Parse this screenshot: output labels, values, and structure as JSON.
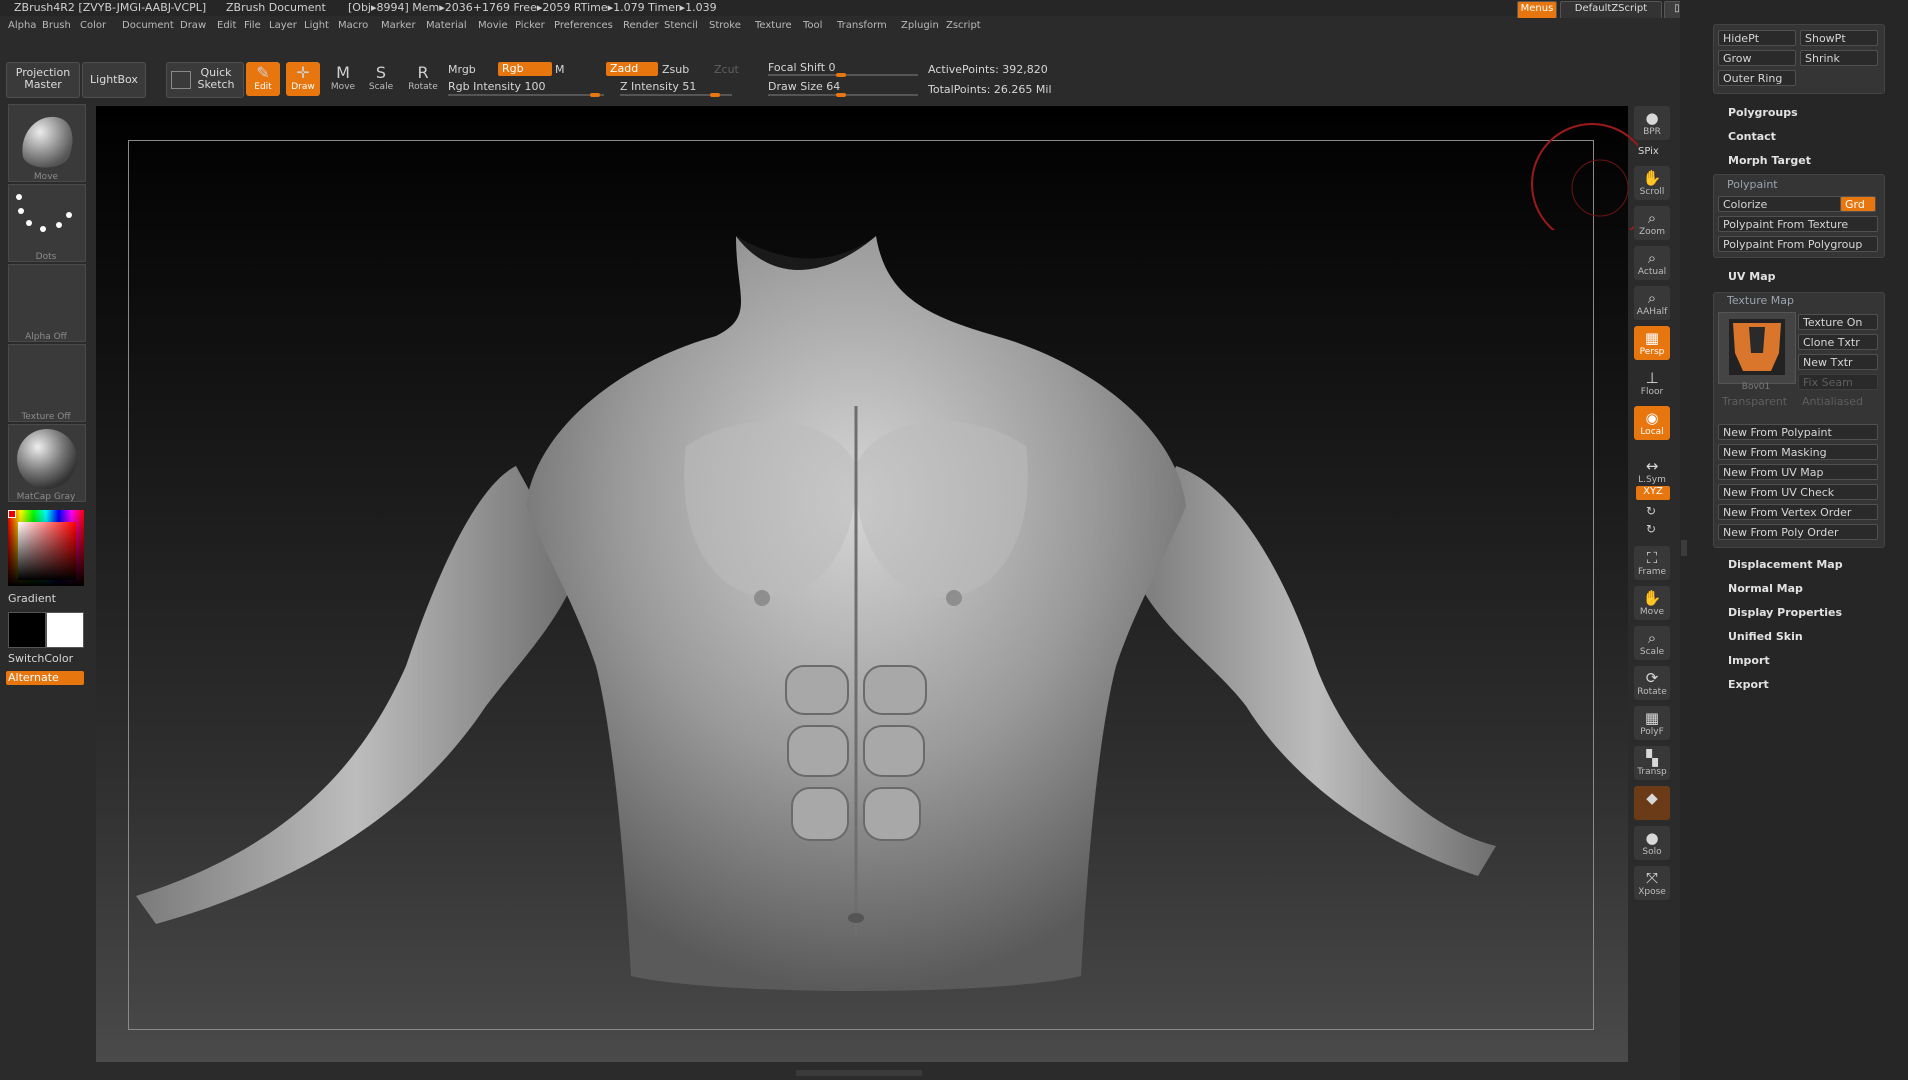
{
  "titlebar": {
    "app": "ZBrush4R2 [ZVYB-JMGI-AABJ-VCPL]",
    "doc": "ZBrush Document",
    "stats": "[Obj▸8994] Mem▸2036+1769 Free▸2059 RTime▸1.079 Timer▸1.039",
    "menus_btn": "Menus",
    "script": "DefaultZScript"
  },
  "menubar": [
    "Alpha",
    "Brush",
    "Color",
    "Document",
    "Draw",
    "Edit",
    "File",
    "Layer",
    "Light",
    "Macro",
    "Marker",
    "Material",
    "Movie",
    "Picker",
    "Preferences",
    "Render",
    "Stencil",
    "Stroke",
    "Texture",
    "Tool",
    "Transform",
    "Zplugin",
    "Zscript"
  ],
  "toolbar": {
    "projection_master": "Projection Master",
    "lightbox": "LightBox",
    "quick_sketch": "Quick Sketch",
    "edit": "Edit",
    "draw": "Draw",
    "move": "Move",
    "scale": "Scale",
    "rotate": "Rotate",
    "mrgb": "Mrgb",
    "rgb": "Rgb",
    "m": "M",
    "zadd": "Zadd",
    "zsub": "Zsub",
    "zcut": "Zcut",
    "rgb_intensity": "Rgb Intensity 100",
    "z_intensity": "Z Intensity 51",
    "focal_shift": "Focal Shift 0",
    "draw_size": "Draw Size 64",
    "active_points": "ActivePoints: 392,820",
    "total_points": "TotalPoints: 26.265 Mil"
  },
  "left_shelf": {
    "brush": "Move",
    "stroke": "Dots",
    "alpha": "Alpha Off",
    "texture": "Texture Off",
    "material": "MatCap Gray",
    "gradient": "Gradient",
    "switch_color": "SwitchColor",
    "alternate": "Alternate"
  },
  "nav": [
    "BPR",
    "SPix",
    "Scroll",
    "Zoom",
    "Actual",
    "AAHalf",
    "Persp",
    "Floor",
    "Local",
    "L.Sym",
    "XYZ",
    "Frame",
    "Move",
    "Scale",
    "Rotate",
    "PolyF",
    "Transp",
    "Solo",
    "Xpose"
  ],
  "tray": {
    "hide_pt": "HidePt",
    "show_pt": "ShowPt",
    "grow": "Grow",
    "shrink": "Shrink",
    "outer_ring": "Outer Ring",
    "polygroups": "Polygroups",
    "contact": "Contact",
    "morph_target": "Morph Target",
    "polypaint": "Polypaint",
    "colorize": "Colorize",
    "grd": "Grd",
    "pp_from_texture": "Polypaint From Texture",
    "pp_from_polygroup": "Polypaint From Polygroup",
    "uv_map": "UV Map",
    "texture_map": "Texture Map",
    "texture_on": "Texture On",
    "clone_txtr": "Clone Txtr",
    "new_txtr": "New Txtr",
    "fix_seam": "Fix Seam",
    "thumb_caption": "Bov01",
    "transparent": "Transparent",
    "antialiased": "Antialiased",
    "new_from_polypaint": "New From Polypaint",
    "new_from_masking": "New From Masking",
    "new_from_uv_map": "New From UV Map",
    "new_from_uv_check": "New From UV Check",
    "new_from_vertex_order": "New From Vertex Order",
    "new_from_poly_order": "New From Poly Order",
    "displacement_map": "Displacement Map",
    "normal_map": "Normal Map",
    "display_properties": "Display Properties",
    "unified_skin": "Unified Skin",
    "import": "Import",
    "export": "Export"
  },
  "colors": {
    "accent": "#e8760f",
    "bg": "#2b2b2b"
  }
}
